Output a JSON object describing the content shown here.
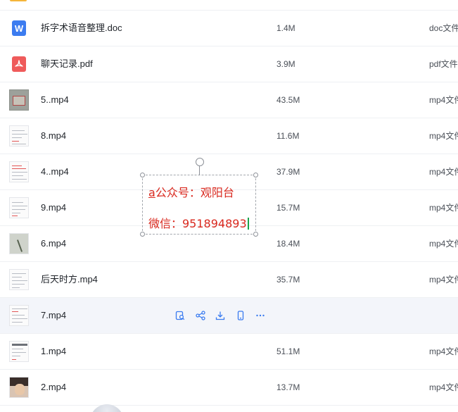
{
  "files": [
    {
      "name": "拆字术语音整理.doc",
      "size": "1.4M",
      "type": "doc文件",
      "kind": "doc",
      "icon": "word-file-icon"
    },
    {
      "name": "聊天记录.pdf",
      "size": "3.9M",
      "type": "pdf文件",
      "kind": "pdf",
      "icon": "pdf-file-icon"
    },
    {
      "name": "5..mp4",
      "size": "43.5M",
      "type": "mp4文件",
      "kind": "video",
      "icon": "video-thumbnail"
    },
    {
      "name": "8.mp4",
      "size": "11.6M",
      "type": "mp4文件",
      "kind": "video",
      "icon": "video-thumbnail"
    },
    {
      "name": "4..mp4",
      "size": "37.9M",
      "type": "mp4文件",
      "kind": "video",
      "icon": "video-thumbnail"
    },
    {
      "name": "9.mp4",
      "size": "15.7M",
      "type": "mp4文件",
      "kind": "video",
      "icon": "video-thumbnail"
    },
    {
      "name": "6.mp4",
      "size": "18.4M",
      "type": "mp4文件",
      "kind": "video",
      "icon": "video-thumbnail"
    },
    {
      "name": "后天时方.mp4",
      "size": "35.7M",
      "type": "mp4文件",
      "kind": "video",
      "icon": "video-thumbnail"
    },
    {
      "name": "7.mp4",
      "size": "",
      "type": "",
      "kind": "video",
      "icon": "video-thumbnail",
      "hovered": true
    },
    {
      "name": "1.mp4",
      "size": "51.1M",
      "type": "mp4文件",
      "kind": "video",
      "icon": "video-thumbnail"
    },
    {
      "name": "2.mp4",
      "size": "13.7M",
      "type": "mp4文件",
      "kind": "video",
      "icon": "video-thumbnail"
    }
  ],
  "row_actions": [
    {
      "name": "preview-icon"
    },
    {
      "name": "share-icon"
    },
    {
      "name": "download-icon"
    },
    {
      "name": "phone-icon"
    },
    {
      "name": "more-icon"
    }
  ],
  "watermark": {
    "line1_prefix": "a",
    "line1": "公众号：观阳台",
    "line2": "微信：951894893"
  },
  "colors": {
    "accent": "#3a7bf0",
    "watermark_text": "#d9281e",
    "row_hover": "#f3f5fa"
  }
}
